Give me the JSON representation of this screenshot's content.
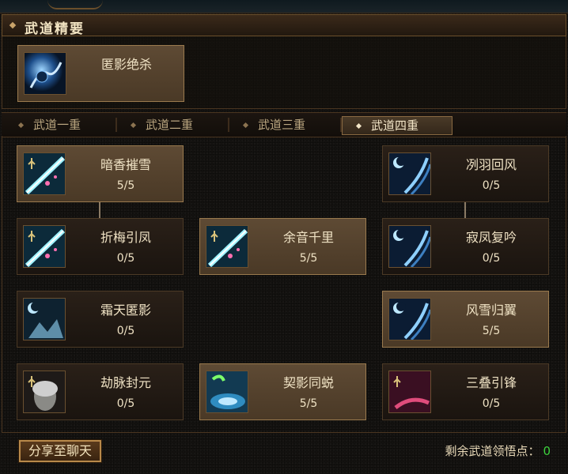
{
  "header": {
    "title": "武道精要"
  },
  "top_skill": {
    "name": "匿影绝杀",
    "icon": "shadow-kill-icon"
  },
  "tabs": [
    {
      "label": "武道一重",
      "active": false
    },
    {
      "label": "武道二重",
      "active": false
    },
    {
      "label": "武道三重",
      "active": false
    },
    {
      "label": "武道四重",
      "active": true
    }
  ],
  "skills": [
    {
      "name": "暗香摧雪",
      "level": "5/5",
      "icon": "ice-blade-icon",
      "active": true
    },
    {
      "name": "冽羽回风",
      "level": "0/5",
      "icon": "moon-wind-icon",
      "active": false
    },
    {
      "name": "折梅引凤",
      "level": "0/5",
      "icon": "ice-blade-icon",
      "active": false
    },
    {
      "name": "余音千里",
      "level": "5/5",
      "icon": "ice-blade-icon",
      "active": true
    },
    {
      "name": "寂凤复吟",
      "level": "0/5",
      "icon": "moon-wind-icon",
      "active": false
    },
    {
      "name": "霜天匿影",
      "level": "0/5",
      "icon": "frost-shadow-icon",
      "active": false
    },
    {
      "name": "风雪归翼",
      "level": "5/5",
      "icon": "moon-wind-icon",
      "active": true
    },
    {
      "name": "劫脉封元",
      "level": "0/5",
      "icon": "elder-face-icon",
      "active": false
    },
    {
      "name": "契影同蜕",
      "level": "5/5",
      "icon": "water-vortex-icon",
      "active": true
    },
    {
      "name": "三叠引锋",
      "level": "0/5",
      "icon": "crimson-blade-icon",
      "active": false
    }
  ],
  "footer": {
    "share_label": "分享至聊天",
    "remaining_label": "剩余武道领悟点：",
    "remaining_value": "0"
  }
}
